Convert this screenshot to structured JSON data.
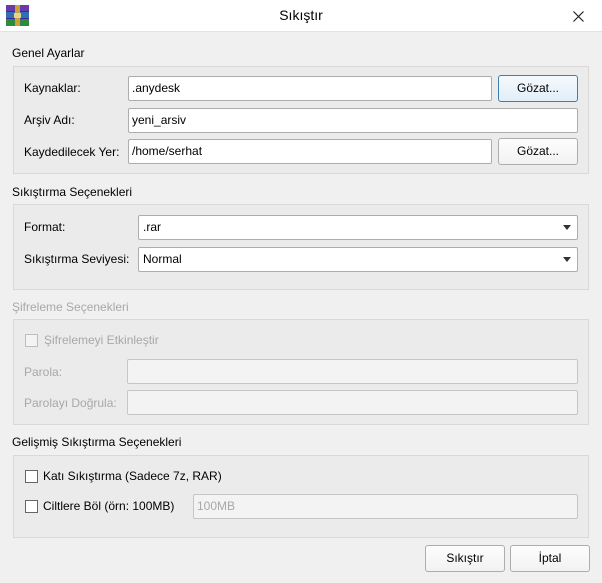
{
  "window": {
    "title": "Sıkıştır"
  },
  "general": {
    "section_title": "Genel Ayarlar",
    "sources_label": "Kaynaklar:",
    "sources_value": ".anydesk",
    "browse_label": "Gözat...",
    "archive_name_label": "Arşiv Adı:",
    "archive_name_value": "yeni_arsiv",
    "save_location_label": "Kaydedilecek Yer:",
    "save_location_value": "/home/serhat"
  },
  "compression": {
    "section_title": "Sıkıştırma Seçenekleri",
    "format_label": "Format:",
    "format_value": ".rar",
    "level_label": "Sıkıştırma Seviyesi:",
    "level_value": "Normal"
  },
  "encryption": {
    "section_title": "Şifreleme Seçenekleri",
    "enable_label": "Şifrelemeyi Etkinleştir",
    "enable_checked": false,
    "password_label": "Parola:",
    "confirm_label": "Parolayı Doğrula:"
  },
  "advanced": {
    "section_title": "Gelişmiş Sıkıştırma Seçenekleri",
    "solid_label": "Katı Sıkıştırma (Sadece 7z, RAR)",
    "solid_checked": false,
    "split_label": "Ciltlere Böl (örn: 100MB)",
    "split_checked": false,
    "split_placeholder": "100MB"
  },
  "footer": {
    "compress_label": "Sıkıştır",
    "cancel_label": "İptal"
  }
}
